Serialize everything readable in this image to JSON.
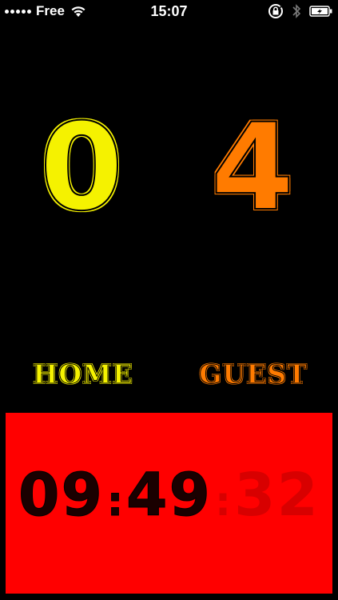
{
  "status_bar": {
    "carrier": "Free",
    "time": "15:07",
    "signal_bars": 5,
    "icons": [
      "wifi-icon",
      "rotation-lock-icon",
      "bluetooth-icon",
      "battery-icon"
    ]
  },
  "scoreboard": {
    "home": {
      "score": "0",
      "label": "HOME",
      "color": "#f5f200"
    },
    "guest": {
      "score": "4",
      "label": "GUEST",
      "color": "#ff7b00"
    }
  },
  "timer": {
    "minutes": "09",
    "seconds": "49",
    "fraction": "32",
    "separator": ":",
    "panel_color": "#ff0000"
  }
}
